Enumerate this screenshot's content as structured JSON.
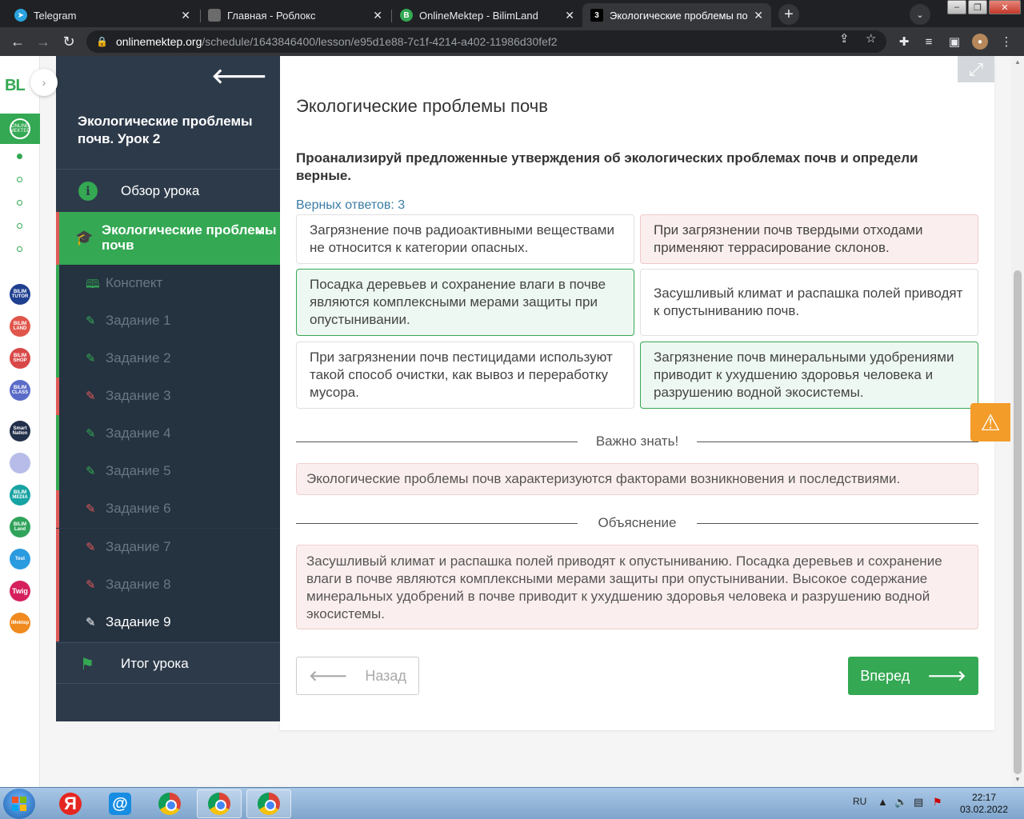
{
  "browser": {
    "tabs": [
      {
        "label": "Telegram",
        "active": false
      },
      {
        "label": "Главная - Роблокс",
        "active": false
      },
      {
        "label": "OnlineMektep - BilimLand",
        "active": false
      },
      {
        "label": "Экологические проблемы почв",
        "active": true
      }
    ],
    "new_tab": "+",
    "url_host": "onlinemektep.org",
    "url_path": "/schedule/1643846400/lesson/e95d1e88-7c1f-4214-a402-11986d30fef2"
  },
  "strip": {
    "logo": "BL",
    "om_label": "ONLINE MEKTEP",
    "apps": [
      {
        "label": "BILIM TUTOR",
        "color": "#1f3f8f"
      },
      {
        "label": "BILIM LAND",
        "color": "#e0564b"
      },
      {
        "label": "BILIM SHOP",
        "color": "#d94848"
      },
      {
        "label": "BILIM CLASS",
        "color": "#5a6bc8"
      },
      {
        "label": "Smart Nation",
        "color": "#22304a"
      },
      {
        "label": "",
        "color": "#b7bde8"
      },
      {
        "label": "BILIM MEDIA",
        "color": "#18a3a3"
      },
      {
        "label": "BILIM Land",
        "color": "#2fa35a"
      },
      {
        "label": "Test",
        "color": "#2b9be0"
      },
      {
        "label": "Twig",
        "color": "#d6205e"
      },
      {
        "label": "iMektep",
        "color": "#f08a1f"
      }
    ],
    "colors": {
      "accent": "#34a853"
    }
  },
  "sidebar": {
    "lesson_title": "Экологические проблемы почв. Урок 2",
    "overview": "Обзор урока",
    "active_section": "Экологические проблемы почв",
    "items": [
      {
        "label": "Конспект",
        "state": "ok",
        "icon": "book-icon"
      },
      {
        "label": "Задание 1",
        "state": "ok",
        "icon": "edit-icon"
      },
      {
        "label": "Задание 2",
        "state": "ok",
        "icon": "edit-icon"
      },
      {
        "label": "Задание 3",
        "state": "bad",
        "icon": "edit-icon"
      },
      {
        "label": "Задание 4",
        "state": "ok",
        "icon": "edit-icon"
      },
      {
        "label": "Задание 5",
        "state": "ok",
        "icon": "edit-icon"
      },
      {
        "label": "Задание 6",
        "state": "bad",
        "icon": "edit-icon"
      },
      {
        "label": "Задание 7",
        "state": "bad",
        "icon": "edit-icon"
      },
      {
        "label": "Задание 8",
        "state": "bad",
        "icon": "edit-icon"
      },
      {
        "label": "Задание 9",
        "state": "current",
        "icon": "edit-icon"
      }
    ],
    "final": "Итог урока"
  },
  "exercise": {
    "title": "Экологические проблемы почв",
    "question": "Проанализируй предложенные утверждения об экологических проблемах почв и определи верные.",
    "correct_count": "Верных ответов: 3",
    "options": [
      {
        "text": "Загрязнение почв радиоактивными веществами не относится к категории опасных.",
        "state": "neutral"
      },
      {
        "text": "При загрязнении почв твердыми отходами применяют террасирование склонов.",
        "state": "wrong"
      },
      {
        "text": "Посадка деревьев и сохранение влаги в почве являются комплексными мерами защиты при опустынивании.",
        "state": "correct"
      },
      {
        "text": "Засушливый климат и распашка полей приводят к опустыниванию почв.",
        "state": "neutral"
      },
      {
        "text": "При загрязнении почв пестицидами используют такой способ очистки, как вывоз и переработку мусора.",
        "state": "neutral"
      },
      {
        "text": "Загрязнение почв минеральными удобрениями приводит к ухудшению здоровья человека и разрушению водной экосистемы.",
        "state": "correct"
      }
    ],
    "important_heading": "Важно знать!",
    "important_text": "Экологические проблемы почв характеризуются факторами возникновения и последствиями.",
    "explanation_heading": "Объяснение",
    "explanation_text": "Засушливый климат и распашка полей приводят к опустыниванию. Посадка деревьев и сохранение влаги в почве являются комплексными мерами защиты при опустынивании. Высокое содержание минеральных удобрений в почве приводит к ухудшению здоровья человека и разрушению водной экосистемы.",
    "back_label": "Назад",
    "next_label": "Вперед"
  },
  "taskbar": {
    "lang": "RU",
    "time": "22:17",
    "date": "03.02.2022",
    "yandex": "Я",
    "mail": "@"
  },
  "colors": {
    "green": "#34a853",
    "sidebar": "#2d3a4a",
    "red": "#e05a5a",
    "warning": "#f39c2a"
  }
}
